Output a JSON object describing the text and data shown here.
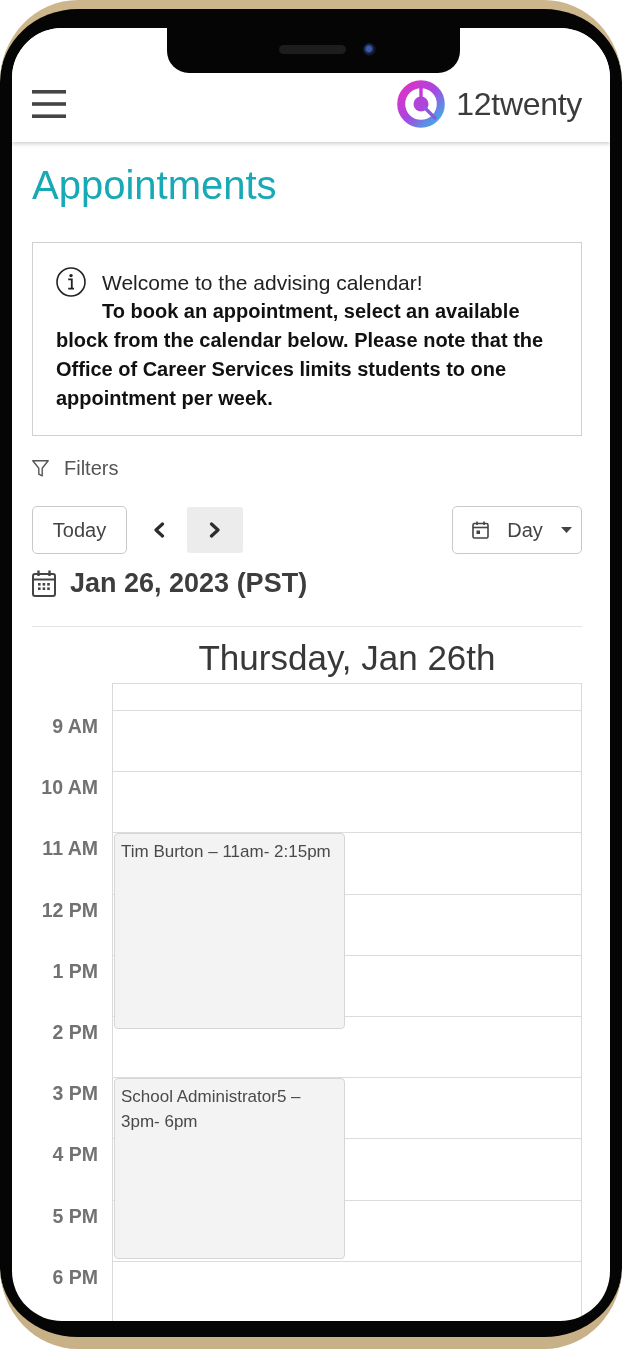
{
  "header": {
    "brand": "12twenty"
  },
  "page": {
    "title": "Appointments"
  },
  "notice": {
    "welcome": "Welcome to the advising calendar!",
    "message": "To book an appointment, select an available block from the calendar below. Please note that the Office of Career Services limits students to one appointment per week."
  },
  "filters": {
    "label": "Filters"
  },
  "toolbar": {
    "today": "Today",
    "nav_buttons": [
      {
        "kind": "previous",
        "focused": false
      },
      {
        "kind": "next",
        "focused": true
      }
    ],
    "view": "Day"
  },
  "date_heading": "Jan 26, 2023 (PST)",
  "calendar": {
    "day_title": "Thursday, Jan 26th",
    "hours": [
      "9 AM",
      "10 AM",
      "11 AM",
      "12 PM",
      "1 PM",
      "2 PM",
      "3 PM",
      "4 PM",
      "5 PM",
      "6 PM"
    ],
    "events": [
      {
        "text": "Tim Burton – 11am- 2:15pm"
      },
      {
        "text": "School Administrator5 – 3pm- 6pm"
      }
    ]
  }
}
